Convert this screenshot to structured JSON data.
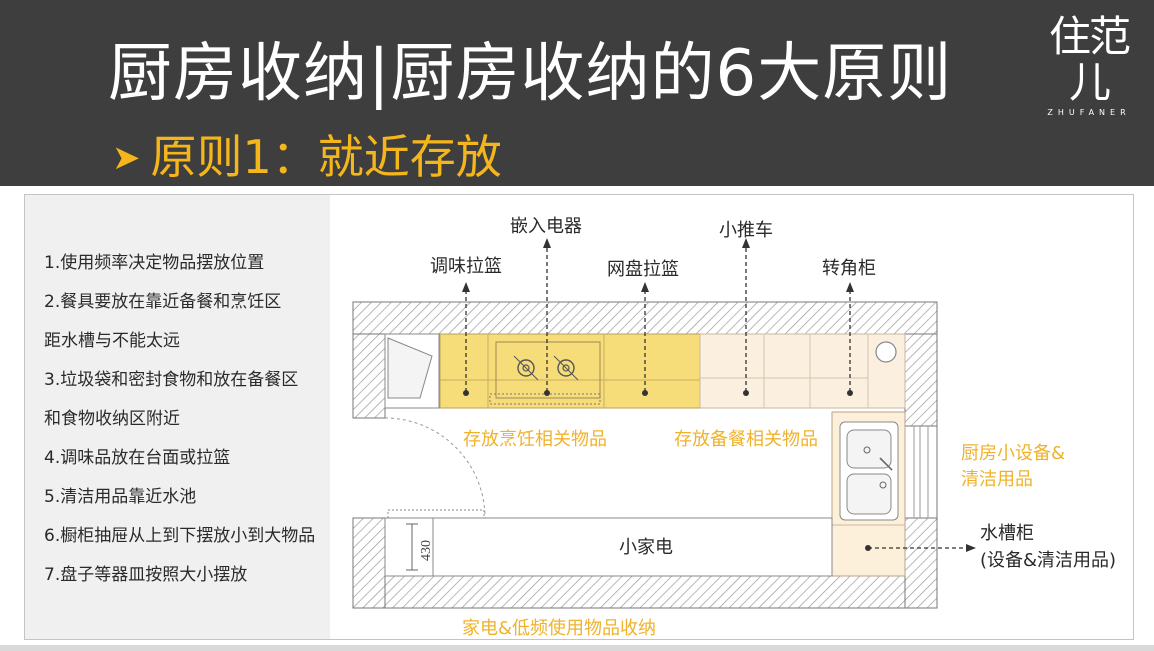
{
  "header": {
    "title": "厨房收纳|厨房收纳的6大原则",
    "subtitle_arrow": "➤",
    "subtitle": "原则1：就近存放",
    "logo_glyphs": "住范儿",
    "logo_latin": "ZHUFANER"
  },
  "rules": [
    "1.使用频率决定物品摆放位置",
    "2.餐具要放在靠近备餐和烹饪区",
    "距水槽与不能太远",
    "3.垃圾袋和密封食物和放在备餐区",
    "和食物收纳区附近",
    "4.调味品放在台面或拉篮",
    "5.清洁用品靠近水池",
    "6.橱柜抽屉从上到下摆放小到大物品",
    "7.盘子等器皿按照大小摆放"
  ],
  "diagram": {
    "labels": {
      "built_in_appliance": "嵌入电器",
      "seasoning_basket": "调味拉篮",
      "dish_basket": "网盘拉篮",
      "trolley": "小推车",
      "corner_cabinet": "转角柜",
      "cooking_zone": "存放烹饪相关物品",
      "prep_zone": "存放备餐相关物品",
      "small_devices": "厨房小设备&",
      "cleaning_supplies": "清洁用品",
      "small_appliances": "小家电",
      "sink_cabinet": "水槽柜",
      "sink_cabinet_detail": "(设备&清洁用品)",
      "appliance_storage": "家电&低频使用物品收纳",
      "dimension": "430"
    },
    "colors": {
      "cooking_highlight": "#f7dc7a",
      "prep_highlight": "#fbf0e0",
      "sink_highlight": "#fdf0da",
      "accent_orange": "#f0b22a"
    }
  }
}
